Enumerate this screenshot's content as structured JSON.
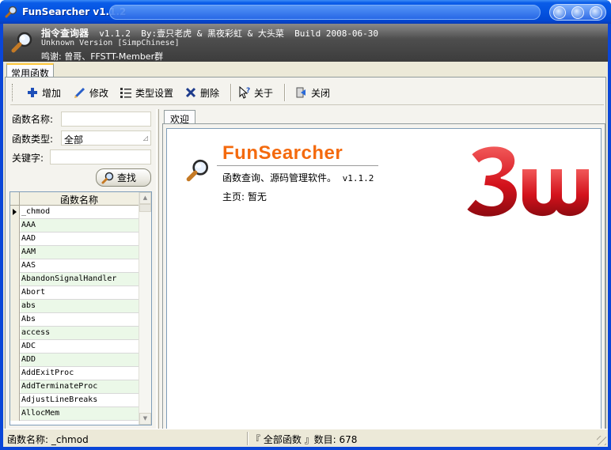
{
  "window": {
    "title": "FunSearcher v1.1.2",
    "accent": "#0a5ce8"
  },
  "banner": {
    "app_name": "指令查询器",
    "line1_rest": "  v1.1.2  By:壹只老虎 & 黑夜彩虹 & 大头菜  Build 2008-06-30",
    "line2": "Unknown Version [SimpChinese]",
    "line3": "鸣谢: 曾哥、FFSTT-Member群"
  },
  "outer_tab": {
    "label": "常用函数"
  },
  "toolbar": {
    "add": "增加",
    "edit": "修改",
    "types": "类型设置",
    "delete": "删除",
    "about": "关于",
    "close": "关闭"
  },
  "search": {
    "name_label": "函数名称:",
    "name_value": "",
    "type_label": "函数类型:",
    "type_value": "全部",
    "keyword_label": "关键字:",
    "keyword_value": "",
    "find_label": "查找"
  },
  "grid": {
    "header": "函数名称",
    "rows": [
      "_chmod",
      "AAA",
      "AAD",
      "AAM",
      "AAS",
      "AbandonSignalHandler",
      "Abort",
      "abs",
      "Abs",
      "access",
      "ADC",
      "ADD",
      "AddExitProc",
      "AddTerminateProc",
      "AdjustLineBreaks",
      "AllocMem"
    ],
    "row_tint": "#ebf8e8"
  },
  "inner_tab": {
    "label": "欢迎"
  },
  "welcome": {
    "title": "FunSearcher",
    "desc": "函数查询、源码管理软件。",
    "version": "v1.1.2",
    "home": "主页: 暂无",
    "title_color": "#f46a0e",
    "logo": "3w-logo"
  },
  "status": {
    "left": "函数名称: _chmod",
    "right": "『 全部函数 』数目: 678"
  }
}
